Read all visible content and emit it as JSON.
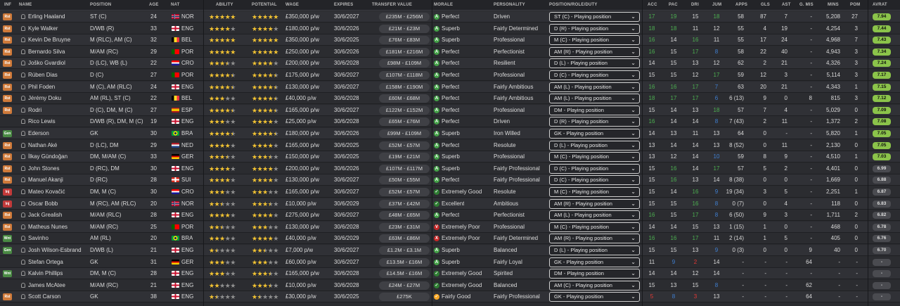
{
  "colors": {
    "positive": "#43a047",
    "excellent": "#2e7d32",
    "negative": "#c62828",
    "neutral": "#f9a825",
    "star": "#f1c232",
    "avrat_high": "#8bc34a",
    "avrat_low": "#4a4b50",
    "attr_high": "#4caf50",
    "attr_mid": "#d8d8d8",
    "attr_low": "#3f7fd1",
    "attr_bad": "#e53935"
  },
  "headers": {
    "inf": "INF",
    "name": "NAME",
    "position": "POSITION",
    "age": "AGE",
    "nat": "NAT",
    "ability": "ABILITY",
    "potential": "POTENTIAL",
    "wage": "WAGE",
    "expires": "EXPIRES",
    "transfer_value": "TRANSFER VALUE",
    "morale": "MORALE",
    "personality": "PERSONALITY",
    "prd": "POSITION/ROLE/DUTY",
    "acc": "ACC",
    "pac": "PAC",
    "dri": "DRI",
    "jum": "JUM",
    "apps": "APPS",
    "gls": "GLS",
    "ast": "AST",
    "gmis": "G. MIS",
    "mins": "MINS",
    "pom": "POM",
    "avrat": "AVRAT"
  },
  "players": [
    {
      "inf": "Rst",
      "name": "Erling Haaland",
      "position": "ST (C)",
      "age": "24",
      "nat": "NOR",
      "flag": "nor",
      "ability": 5,
      "potential": 5,
      "wage": "£350,000 p/w",
      "expires": "30/6/2027",
      "value": "£235M - £256M",
      "morale": "Perfect",
      "morale_icon": "A",
      "personality": "Driven",
      "prd": "ST (C) - Playing position",
      "acc": "17",
      "pac": "19",
      "dri": "15",
      "jum": "18",
      "apps": "58",
      "gls": "87",
      "ast": "7",
      "gmis": "-",
      "mins": "5,208",
      "pom": "27",
      "avrat": "7.94"
    },
    {
      "inf": "Rst",
      "name": "Kyle Walker",
      "position": "D/WB (R)",
      "age": "33",
      "nat": "ENG",
      "flag": "eng",
      "ability": 4,
      "potential": 4,
      "wage": "£180,000 p/w",
      "expires": "30/6/2026",
      "value": "£21M - £23M",
      "morale": "Superb",
      "morale_icon": "A",
      "personality": "Fairly Determined",
      "prd": "D (R) - Playing position",
      "acc": "18",
      "pac": "18",
      "dri": "11",
      "jum": "12",
      "apps": "55",
      "gls": "4",
      "ast": "19",
      "gmis": "-",
      "mins": "4,254",
      "pom": "3",
      "avrat": "7.44"
    },
    {
      "inf": "Rst",
      "name": "Kevin De Bruyne",
      "position": "M (RLC), AM (C)",
      "age": "32",
      "nat": "BEL",
      "flag": "bel",
      "ability": 5,
      "potential": 5,
      "wage": "£350,000 p/w",
      "expires": "30/6/2025",
      "value": "£76M - £83M",
      "morale": "Superb",
      "morale_icon": "A",
      "personality": "Professional",
      "prd": "M (C) - Playing position",
      "acc": "16",
      "pac": "14",
      "dri": "16",
      "jum": "11",
      "apps": "55",
      "gls": "17",
      "ast": "24",
      "gmis": "-",
      "mins": "4,968",
      "pom": "7",
      "avrat": "7.43"
    },
    {
      "inf": "Rst",
      "name": "Bernardo Silva",
      "position": "M/AM (RC)",
      "age": "29",
      "nat": "POR",
      "flag": "por",
      "ability": 5,
      "potential": 5,
      "wage": "£250,000 p/w",
      "expires": "30/6/2026",
      "value": "£181M - £216M",
      "morale": "Perfect",
      "morale_icon": "A",
      "personality": "Perfectionist",
      "prd": "AM (R) - Playing position",
      "acc": "16",
      "pac": "15",
      "dri": "17",
      "jum": "8",
      "apps": "58",
      "gls": "22",
      "ast": "40",
      "gmis": "-",
      "mins": "4,943",
      "pom": "3",
      "avrat": "7.34"
    },
    {
      "inf": "Rst",
      "name": "Joško Gvardiol",
      "position": "D (LC), WB (L)",
      "age": "22",
      "nat": "CRO",
      "flag": "cro",
      "ability": 3.5,
      "potential": 4,
      "wage": "£200,000 p/w",
      "expires": "30/6/2028",
      "value": "£98M - £109M",
      "morale": "Perfect",
      "morale_icon": "A",
      "personality": "Resilient",
      "prd": "D (L) - Playing position",
      "acc": "14",
      "pac": "15",
      "dri": "13",
      "jum": "12",
      "apps": "62",
      "gls": "2",
      "ast": "21",
      "gmis": "-",
      "mins": "4,326",
      "pom": "3",
      "avrat": "7.24"
    },
    {
      "inf": "Rst",
      "name": "Rúben Dias",
      "position": "D (C)",
      "age": "27",
      "nat": "POR",
      "flag": "por",
      "ability": 4.5,
      "potential": 4.5,
      "wage": "£175,000 p/w",
      "expires": "30/6/2027",
      "value": "£107M - £118M",
      "morale": "Perfect",
      "morale_icon": "A",
      "personality": "Professional",
      "prd": "D (C) - Playing position",
      "acc": "15",
      "pac": "15",
      "dri": "12",
      "jum": "17",
      "apps": "59",
      "gls": "12",
      "ast": "3",
      "gmis": "-",
      "mins": "5,114",
      "pom": "3",
      "avrat": "7.17"
    },
    {
      "inf": "Rst",
      "name": "Phil Foden",
      "position": "M (C), AM (RLC)",
      "age": "24",
      "nat": "ENG",
      "flag": "eng",
      "ability": 4.5,
      "potential": 4.5,
      "wage": "£130,000 p/w",
      "expires": "30/6/2027",
      "value": "£158M - £190M",
      "morale": "Perfect",
      "morale_icon": "A",
      "personality": "Fairly Ambitious",
      "prd": "AM (L) - Playing position",
      "acc": "16",
      "pac": "16",
      "dri": "17",
      "jum": "7",
      "apps": "63",
      "gls": "20",
      "ast": "21",
      "gmis": "-",
      "mins": "4,343",
      "pom": "1",
      "avrat": "7.15"
    },
    {
      "inf": "Rst",
      "name": "Jérémy Doku",
      "position": "AM (RL), ST (C)",
      "age": "22",
      "nat": "BEL",
      "flag": "bel",
      "ability": 3,
      "potential": 4.5,
      "wage": "£40,000 p/w",
      "expires": "30/6/2028",
      "value": "£60M - £68M",
      "morale": "Perfect",
      "morale_icon": "A",
      "personality": "Fairly Ambitious",
      "prd": "AM (L) - Playing position",
      "acc": "18",
      "pac": "17",
      "dri": "17",
      "jum": "6",
      "apps": "6 (13)",
      "gls": "9",
      "ast": "0",
      "gmis": "8",
      "mins": "815",
      "pom": "3",
      "avrat": "7.12"
    },
    {
      "inf": "Rst",
      "name": "Rodri",
      "position": "D (C), DM, M (C)",
      "age": "27",
      "nat": "ESP",
      "flag": "esp",
      "ability": 4.5,
      "potential": 4.5,
      "wage": "£165,000 p/w",
      "expires": "30/6/2027",
      "value": "£122M - £152M",
      "morale": "Perfect",
      "morale_icon": "A",
      "personality": "Professional",
      "prd": "DM - Playing position",
      "acc": "15",
      "pac": "14",
      "dri": "13",
      "jum": "18",
      "apps": "57",
      "gls": "7",
      "ast": "4",
      "gmis": "-",
      "mins": "5,029",
      "pom": "0",
      "avrat": "7.09"
    },
    {
      "inf": "",
      "name": "Rico Lewis",
      "position": "D/WB (R), DM, M (C)",
      "age": "19",
      "nat": "ENG",
      "flag": "eng",
      "ability": 3,
      "potential": 4,
      "wage": "£25,000 p/w",
      "expires": "30/6/2028",
      "value": "£65M - £76M",
      "morale": "Perfect",
      "morale_icon": "A",
      "personality": "Driven",
      "prd": "D (R) - Playing position",
      "acc": "16",
      "pac": "14",
      "dri": "14",
      "jum": "8",
      "apps": "7 (43)",
      "gls": "2",
      "ast": "11",
      "gmis": "-",
      "mins": "1,372",
      "pom": "2",
      "avrat": "7.08"
    },
    {
      "inf": "Gen",
      "name": "Ederson",
      "position": "GK",
      "age": "30",
      "nat": "BRA",
      "flag": "bra",
      "ability": 4.5,
      "potential": 4.5,
      "wage": "£180,000 p/w",
      "expires": "30/6/2026",
      "value": "£99M - £109M",
      "morale": "Superb",
      "morale_icon": "A",
      "personality": "Iron Willed",
      "prd": "GK - Playing position",
      "acc": "14",
      "pac": "13",
      "dri": "11",
      "jum": "13",
      "apps": "64",
      "gls": "0",
      "ast": "-",
      "gmis": "-",
      "mins": "5,820",
      "pom": "1",
      "avrat": "7.05"
    },
    {
      "inf": "Rst",
      "name": "Nathan Aké",
      "position": "D (LC), DM",
      "age": "29",
      "nat": "NED",
      "flag": "ned",
      "ability": 4,
      "potential": 4,
      "wage": "£165,000 p/w",
      "expires": "30/6/2025",
      "value": "£52M - £57M",
      "morale": "Perfect",
      "morale_icon": "A",
      "personality": "Resolute",
      "prd": "D (L) - Playing position",
      "acc": "13",
      "pac": "14",
      "dri": "14",
      "jum": "13",
      "apps": "8 (52)",
      "gls": "0",
      "ast": "11",
      "gmis": "-",
      "mins": "2,130",
      "pom": "0",
      "avrat": "7.05"
    },
    {
      "inf": "Rst",
      "name": "İlkay Gündoğan",
      "position": "DM, M/AM (C)",
      "age": "33",
      "nat": "GER",
      "flag": "ger",
      "ability": 3.5,
      "potential": 3.5,
      "wage": "£150,000 p/w",
      "expires": "30/6/2025",
      "value": "£19M - £21M",
      "morale": "Superb",
      "morale_icon": "A",
      "personality": "Professional",
      "prd": "M (C) - Playing position",
      "acc": "13",
      "pac": "12",
      "dri": "14",
      "jum": "10",
      "apps": "59",
      "gls": "8",
      "ast": "9",
      "gmis": "-",
      "mins": "4,510",
      "pom": "1",
      "avrat": "7.03"
    },
    {
      "inf": "Rst",
      "name": "John Stones",
      "position": "D (RC), DM",
      "age": "30",
      "nat": "ENG",
      "flag": "eng",
      "ability": 4,
      "potential": 4,
      "wage": "£200,000 p/w",
      "expires": "30/6/2026",
      "value": "£107M - £117M",
      "morale": "Superb",
      "morale_icon": "A",
      "personality": "Fairly Professional",
      "prd": "D (C) - Playing position",
      "acc": "15",
      "pac": "16",
      "dri": "14",
      "jum": "17",
      "apps": "57",
      "gls": "5",
      "ast": "2",
      "gmis": "-",
      "mins": "4,401",
      "pom": "0",
      "avrat": "6.99"
    },
    {
      "inf": "Rst",
      "name": "Manuel Akanji",
      "position": "D (RC)",
      "age": "28",
      "nat": "SUI",
      "flag": "sui",
      "ability": 4,
      "potential": 4,
      "wage": "£130,000 p/w",
      "expires": "30/6/2027",
      "value": "£50M - £55M",
      "morale": "Perfect",
      "morale_icon": "A",
      "personality": "Fairly Professional",
      "prd": "D (C) - Playing position",
      "acc": "15",
      "pac": "16",
      "dri": "13",
      "jum": "14",
      "apps": "8 (38)",
      "gls": "0",
      "ast": "0",
      "gmis": "-",
      "mins": "1,669",
      "pom": "0",
      "avrat": "6.88"
    },
    {
      "inf": "Inj",
      "name": "Mateo Kovačić",
      "position": "DM, M (C)",
      "age": "30",
      "nat": "CRO",
      "flag": "cro",
      "ability": 3,
      "potential": 3,
      "wage": "£165,000 p/w",
      "expires": "30/6/2027",
      "value": "£52M - £57M",
      "morale": "Extremely Good",
      "morale_icon": "✓",
      "personality": "Resolute",
      "prd": "M (C) - Playing position",
      "acc": "15",
      "pac": "14",
      "dri": "16",
      "jum": "9",
      "apps": "19 (34)",
      "gls": "3",
      "ast": "5",
      "gmis": "-",
      "mins": "2,251",
      "pom": "1",
      "avrat": "6.87"
    },
    {
      "inf": "Inj",
      "name": "Oscar Bobb",
      "position": "M (RC), AM (RLC)",
      "age": "20",
      "nat": "NOR",
      "flag": "nor",
      "ability": 2.5,
      "potential": 3.5,
      "wage": "£10,000 p/w",
      "expires": "30/6/2029",
      "value": "£37M - £42M",
      "morale": "Excellent",
      "morale_icon": "✓",
      "personality": "Ambitious",
      "prd": "AM (R) - Playing position",
      "acc": "15",
      "pac": "15",
      "dri": "16",
      "jum": "8",
      "apps": "0 (7)",
      "gls": "0",
      "ast": "4",
      "gmis": "-",
      "mins": "118",
      "pom": "0",
      "avrat": "6.83"
    },
    {
      "inf": "Rst",
      "name": "Jack Grealish",
      "position": "M/AM (RLC)",
      "age": "28",
      "nat": "ENG",
      "flag": "eng",
      "ability": 4,
      "potential": 4,
      "wage": "£275,000 p/w",
      "expires": "30/6/2027",
      "value": "£48M - £65M",
      "morale": "Perfect",
      "morale_icon": "A",
      "personality": "Perfectionist",
      "prd": "AM (L) - Playing position",
      "acc": "16",
      "pac": "15",
      "dri": "17",
      "jum": "8",
      "apps": "6 (50)",
      "gls": "9",
      "ast": "3",
      "gmis": "-",
      "mins": "1,711",
      "pom": "2",
      "avrat": "6.82"
    },
    {
      "inf": "Rst",
      "name": "Matheus Nunes",
      "position": "M/AM (RC)",
      "age": "25",
      "nat": "POR",
      "flag": "por",
      "ability": 2.5,
      "potential": 3,
      "wage": "£130,000 p/w",
      "expires": "30/6/2028",
      "value": "£23M - £31M",
      "morale": "Extremely Poor",
      "morale_icon": "V",
      "personality": "Professional",
      "prd": "M (C) - Playing position",
      "acc": "14",
      "pac": "14",
      "dri": "15",
      "jum": "13",
      "apps": "1 (15)",
      "gls": "1",
      "ast": "0",
      "gmis": "-",
      "mins": "468",
      "pom": "0",
      "avrat": "6.78"
    },
    {
      "inf": "Wnt",
      "name": "Savinho",
      "position": "AM (RL)",
      "age": "20",
      "nat": "BRA",
      "flag": "bra",
      "ability": 3,
      "potential": 4,
      "wage": "£40,000 p/w",
      "expires": "30/6/2029",
      "value": "£63M - £86M",
      "morale": "Extremely Poor",
      "morale_icon": "X",
      "personality": "Fairly Determined",
      "prd": "AM (R) - Playing position",
      "acc": "16",
      "pac": "16",
      "dri": "17",
      "jum": "11",
      "apps": "2 (14)",
      "gls": "1",
      "ast": "5",
      "gmis": "-",
      "mins": "405",
      "pom": "0",
      "avrat": "6.76"
    },
    {
      "inf": "Gen",
      "name": "Josh Wilson-Esbrand",
      "position": "D/WB (L)",
      "age": "21",
      "nat": "ENG",
      "flag": "eng",
      "ability": 1.5,
      "potential": 2.5,
      "wage": "£7,000 p/w",
      "expires": "30/6/2027",
      "value": "£1.2M - £3.1M",
      "morale": "Superb",
      "morale_icon": "A",
      "personality": "Balanced",
      "prd": "D (L) - Playing position",
      "acc": "15",
      "pac": "15",
      "dri": "13",
      "jum": "9",
      "apps": "0 (3)",
      "gls": "0",
      "ast": "0",
      "gmis": "9",
      "mins": "40",
      "pom": "0",
      "avrat": "6.70"
    },
    {
      "inf": "",
      "name": "Stefan Ortega",
      "position": "GK",
      "age": "31",
      "nat": "GER",
      "flag": "ger",
      "ability": 3,
      "potential": 3,
      "wage": "£60,000 p/w",
      "expires": "30/6/2027",
      "value": "£13.5M - £16M",
      "morale": "Superb",
      "morale_icon": "A",
      "personality": "Fairly Loyal",
      "prd": "GK - Playing position",
      "acc": "11",
      "pac": "9",
      "dri": "2",
      "jum": "14",
      "apps": "-",
      "gls": "-",
      "ast": "-",
      "gmis": "64",
      "mins": "-",
      "pom": "-",
      "avrat": "-"
    },
    {
      "inf": "Wnt",
      "name": "Kalvin Phillips",
      "position": "DM, M (C)",
      "age": "28",
      "nat": "ENG",
      "flag": "eng",
      "ability": 3,
      "potential": 3.5,
      "wage": "£165,000 p/w",
      "expires": "30/6/2028",
      "value": "£14.5M - £16M",
      "morale": "Extremely Good",
      "morale_icon": "✓",
      "personality": "Spirited",
      "prd": "DM - Playing position",
      "acc": "14",
      "pac": "14",
      "dri": "12",
      "jum": "14",
      "apps": "-",
      "gls": "-",
      "ast": "-",
      "gmis": "-",
      "mins": "-",
      "pom": "-",
      "avrat": "-"
    },
    {
      "inf": "",
      "name": "James McAtee",
      "position": "M/AM (RC)",
      "age": "21",
      "nat": "ENG",
      "flag": "eng",
      "ability": 2,
      "potential": 3.5,
      "wage": "£10,000 p/w",
      "expires": "30/6/2028",
      "value": "£24M - £27M",
      "morale": "Extremely Good",
      "morale_icon": "✓",
      "personality": "Balanced",
      "prd": "AM (C) - Playing position",
      "acc": "15",
      "pac": "13",
      "dri": "15",
      "jum": "8",
      "apps": "-",
      "gls": "-",
      "ast": "-",
      "gmis": "62",
      "mins": "-",
      "pom": "-",
      "avrat": "-"
    },
    {
      "inf": "Rst",
      "name": "Scott Carson",
      "position": "GK",
      "age": "38",
      "nat": "ENG",
      "flag": "eng",
      "ability": 1.5,
      "potential": 1.5,
      "wage": "£30,000 p/w",
      "expires": "30/6/2025",
      "value": "£275K",
      "morale": "Fairly Good",
      "morale_icon": "✓",
      "personality": "Fairly Professional",
      "prd": "GK - Playing position",
      "acc": "5",
      "pac": "8",
      "dri": "3",
      "jum": "13",
      "apps": "-",
      "gls": "-",
      "ast": "-",
      "gmis": "64",
      "mins": "-",
      "pom": "-",
      "avrat": "-"
    }
  ]
}
